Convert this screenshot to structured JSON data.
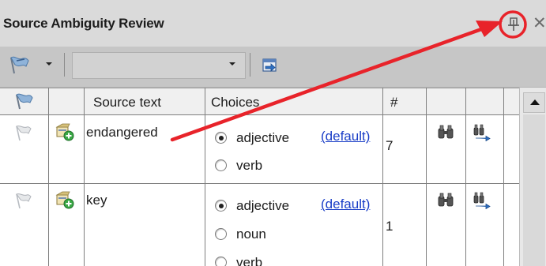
{
  "panel": {
    "title": "Source Ambiguity Review",
    "close_glyph": "✕"
  },
  "toolbar": {
    "combo_value": "",
    "icons": [
      "flag-filter-icon",
      "dropdown-arrow-icon",
      "goto-icon"
    ]
  },
  "grid": {
    "headers": [
      "",
      "",
      "Source text",
      "Choices",
      "#",
      "",
      ""
    ],
    "rows": [
      {
        "source_text": "endangered",
        "count": "7",
        "choices": [
          {
            "label": "adjective",
            "selected": true,
            "default": "(default)"
          },
          {
            "label": "verb",
            "selected": false
          }
        ]
      },
      {
        "source_text": "key",
        "count": "1",
        "choices": [
          {
            "label": "adjective",
            "selected": true,
            "default": "(default)"
          },
          {
            "label": "noun",
            "selected": false
          },
          {
            "label": "verb",
            "selected": false
          }
        ]
      }
    ]
  },
  "colors": {
    "annotation": "#e8232a",
    "link": "#1a3ec7",
    "titlebar": "#dadada",
    "toolbar": "#c6c6c6"
  }
}
